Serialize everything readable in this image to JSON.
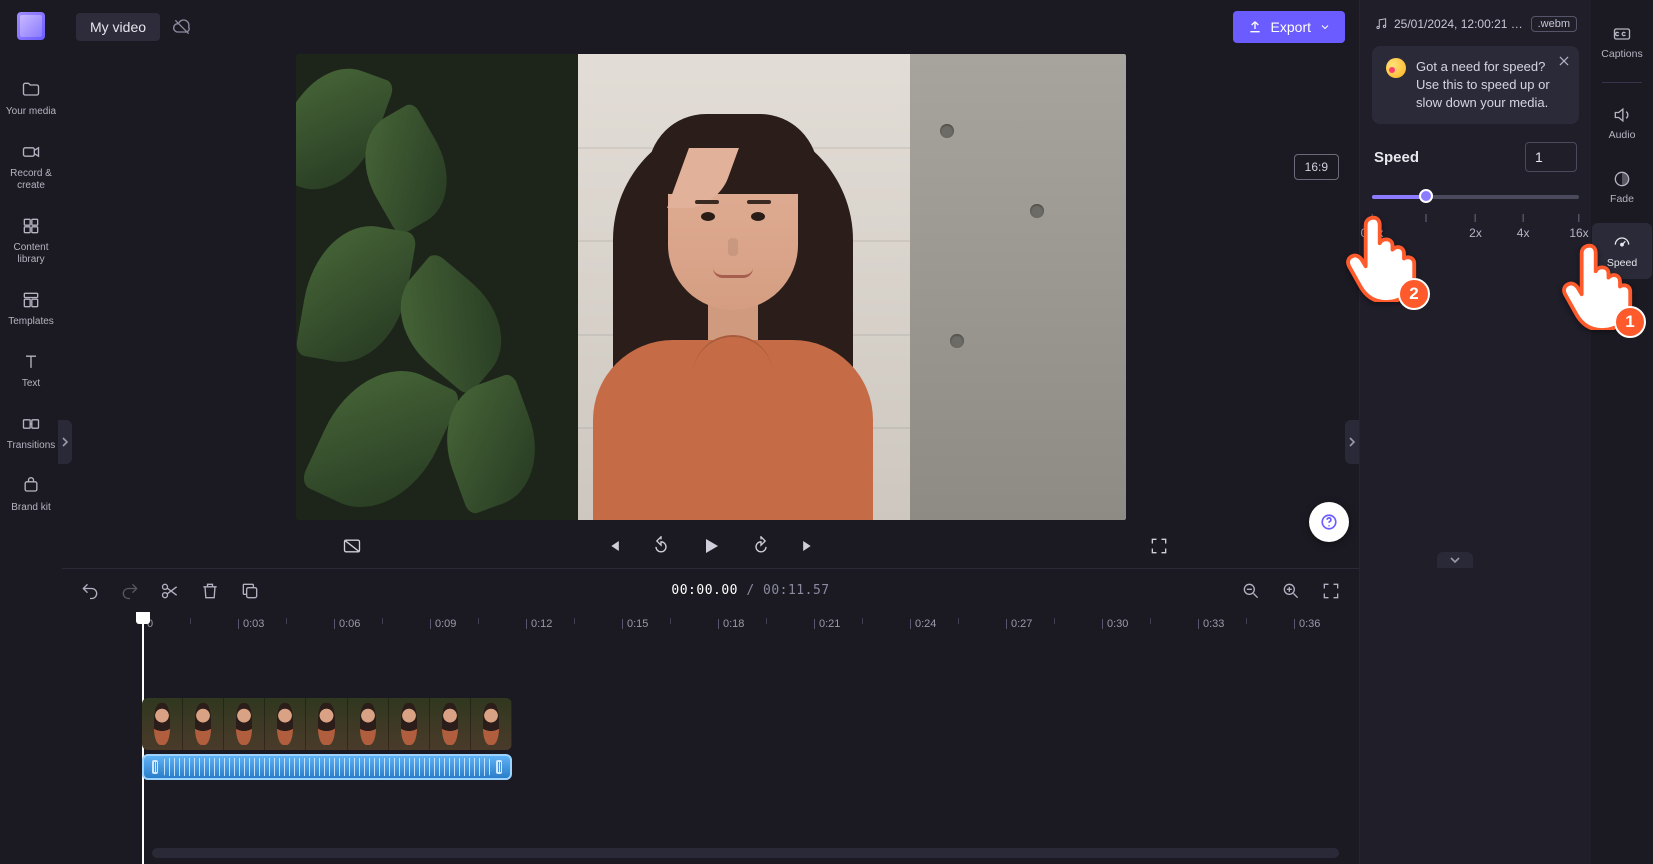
{
  "leftSidebar": {
    "items": [
      {
        "label": "Your media"
      },
      {
        "label": "Record & create"
      },
      {
        "label": "Content library"
      },
      {
        "label": "Templates"
      },
      {
        "label": "Text"
      },
      {
        "label": "Transitions"
      },
      {
        "label": "Brand kit"
      }
    ]
  },
  "topbar": {
    "title": "My video",
    "export_label": "Export"
  },
  "preview": {
    "aspect_label": "16:9"
  },
  "player": {
    "current_time": "00:00.00",
    "separator": " / ",
    "duration": "00:11.57"
  },
  "timeline": {
    "ticks": [
      "0",
      "0:03",
      "0:06",
      "0:09",
      "0:12",
      "0:15",
      "0:18",
      "0:21",
      "0:24",
      "0:27",
      "0:30",
      "0:33",
      "0:36"
    ]
  },
  "rightPanel": {
    "file_name": "25/01/2024, 12:00:21 - Au…",
    "file_ext": ".webm",
    "tip_text": "Got a need for speed? Use this to speed up or slow down your media.",
    "speed_label": "Speed",
    "speed_value": "1",
    "slider_ticks": [
      "0.1x",
      "",
      "2x",
      "4x",
      "16x"
    ]
  },
  "rightRail": {
    "items": [
      {
        "label": "Captions"
      },
      {
        "label": "Audio"
      },
      {
        "label": "Fade"
      },
      {
        "label": "Speed"
      }
    ]
  },
  "annotations": {
    "hand1": "1",
    "hand2": "2"
  },
  "colors": {
    "accent": "#6b5cff",
    "annotation": "#ff5a2b"
  }
}
